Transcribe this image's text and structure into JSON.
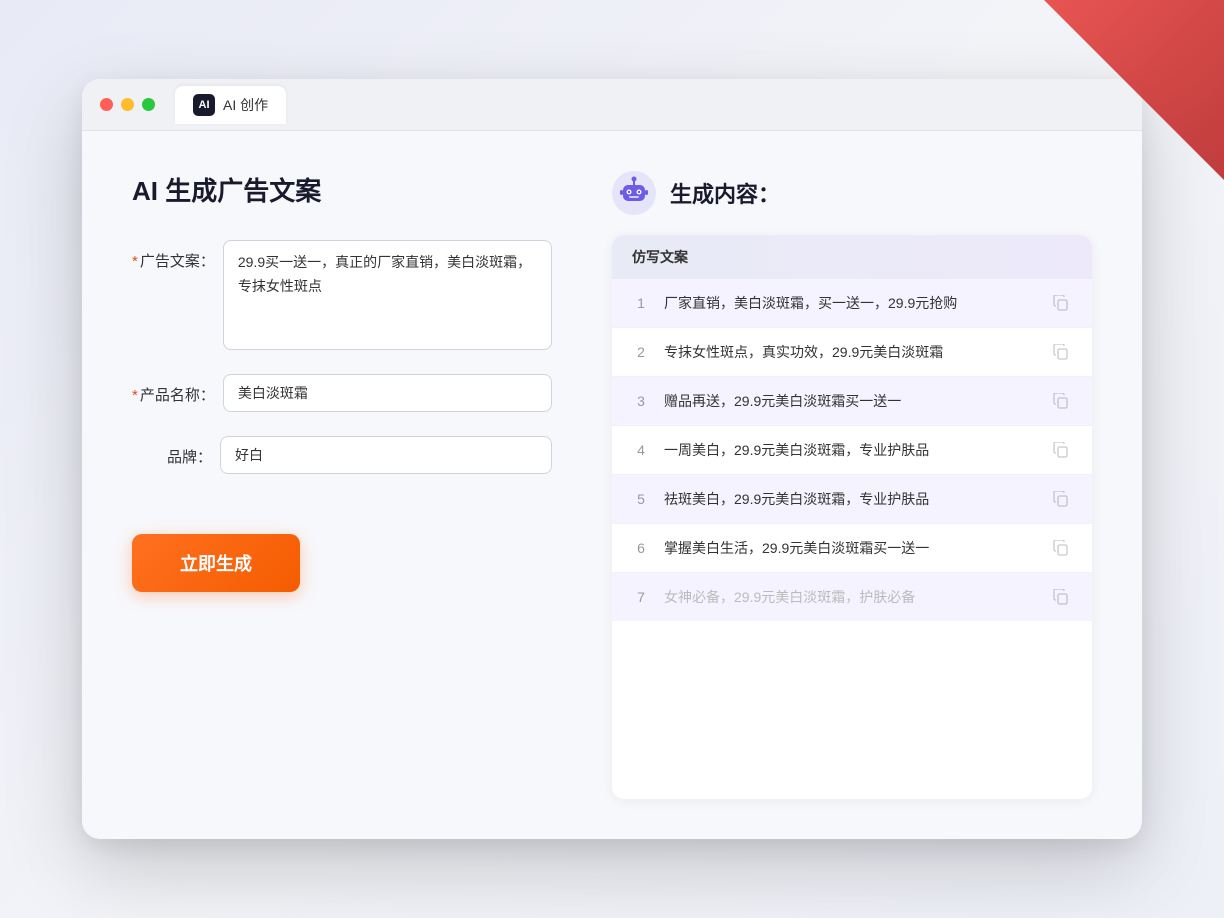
{
  "window": {
    "tab_label": "AI 创作",
    "tab_icon": "AI"
  },
  "left_panel": {
    "title": "AI 生成广告文案",
    "form": {
      "ad_copy_label": "广告文案：",
      "ad_copy_required": "＊",
      "ad_copy_value": "29.9买一送一，真正的厂家直销，美白淡斑霜，专抹女性斑点",
      "product_name_label": "产品名称：",
      "product_name_required": "＊",
      "product_name_value": "美白淡斑霜",
      "brand_label": "品牌：",
      "brand_value": "好白",
      "generate_btn": "立即生成"
    }
  },
  "right_panel": {
    "title": "生成内容：",
    "table_header": "仿写文案",
    "rows": [
      {
        "num": "1",
        "text": "厂家直销，美白淡斑霜，买一送一，29.9元抢购",
        "faded": false
      },
      {
        "num": "2",
        "text": "专抹女性斑点，真实功效，29.9元美白淡斑霜",
        "faded": false
      },
      {
        "num": "3",
        "text": "赠品再送，29.9元美白淡斑霜买一送一",
        "faded": false
      },
      {
        "num": "4",
        "text": "一周美白，29.9元美白淡斑霜，专业护肤品",
        "faded": false
      },
      {
        "num": "5",
        "text": "祛斑美白，29.9元美白淡斑霜，专业护肤品",
        "faded": false
      },
      {
        "num": "6",
        "text": "掌握美白生活，29.9元美白淡斑霜买一送一",
        "faded": false
      },
      {
        "num": "7",
        "text": "女神必备，29.9元美白淡斑霜，护肤必备",
        "faded": true
      }
    ]
  },
  "colors": {
    "accent_orange": "#ff7020",
    "accent_purple": "#7c4dff",
    "required_red": "#e64a19"
  }
}
